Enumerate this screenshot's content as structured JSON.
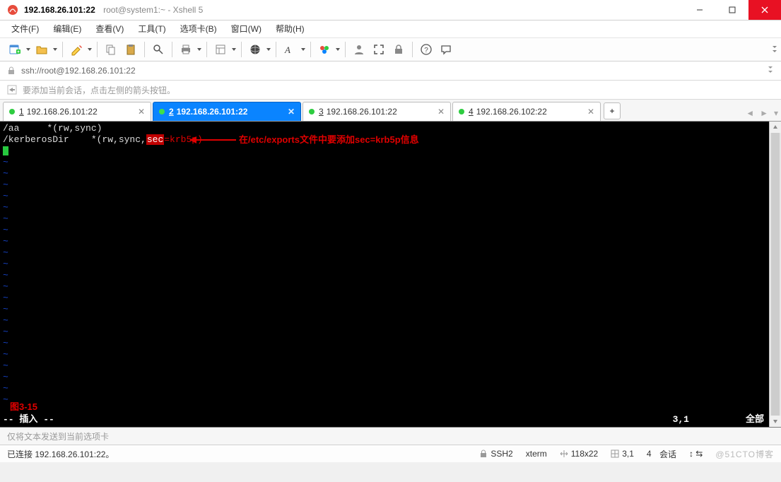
{
  "title": {
    "ip": "192.168.26.101:22",
    "sub": "root@system1:~ - Xshell 5"
  },
  "menu": [
    "文件(F)",
    "编辑(E)",
    "查看(V)",
    "工具(T)",
    "选项卡(B)",
    "窗口(W)",
    "帮助(H)"
  ],
  "addr": {
    "url": "ssh://root@192.168.26.101:22"
  },
  "hint": {
    "text": "要添加当前会话，点击左侧的箭头按钮。"
  },
  "tabs": [
    {
      "n": "1",
      "label": "192.168.26.101:22",
      "active": false
    },
    {
      "n": "2",
      "label": "192.168.26.101:22",
      "active": true
    },
    {
      "n": "3",
      "label": "192.168.26.101:22",
      "active": false
    },
    {
      "n": "4",
      "label": "192.168.26.102:22",
      "active": false
    }
  ],
  "term": {
    "line1": "/aa     *(rw,sync)",
    "line2a": "/kerberosDir    *(rw,sync,",
    "line2sec": "sec",
    "line2b": "=krb5p)",
    "annotation": "在/etc/exports文件中要添加sec=krb5p信息",
    "figlabel": "图3-15",
    "mode": "-- 插入 --",
    "cursor": "3,1",
    "scope": "全部"
  },
  "sendbar": {
    "text": "仅将文本发送到当前选项卡"
  },
  "status": {
    "conn": "已连接 192.168.26.101:22。",
    "proto": "SSH2",
    "termtype": "xterm",
    "size": "118x22",
    "pos": "3,1",
    "sessions_n": "4",
    "sessions_lbl": "会话",
    "watermark": "@51CTO博客"
  }
}
